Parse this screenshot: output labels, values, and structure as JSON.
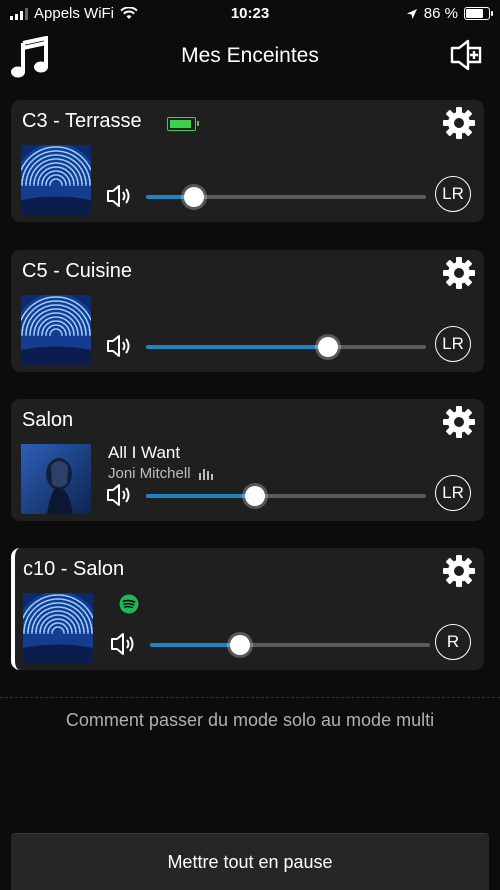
{
  "status": {
    "carrier": "Appels WiFi",
    "time": "10:23",
    "battery": "86 %"
  },
  "header": {
    "title": "Mes Enceintes"
  },
  "speakers": [
    {
      "name": "C3 - Terrasse",
      "volume": 0.17,
      "channel": "LR",
      "song": "",
      "artist": "",
      "battery_icon": "battery-full-green-icon"
    },
    {
      "name": "C5 - Cuisine",
      "volume": 0.65,
      "channel": "LR",
      "song": "",
      "artist": ""
    },
    {
      "name": "Salon",
      "volume": 0.39,
      "channel": "LR",
      "song": "All I Want",
      "artist": "Joni Mitchell"
    },
    {
      "name": "c10 - Salon",
      "volume": 0.32,
      "channel": "R",
      "song": "",
      "artist": "",
      "source_icon": "spotify-icon"
    }
  ],
  "help_text": "Comment passer du mode solo au mode multi",
  "pause_all_label": "Mettre tout en pause",
  "colors": {
    "accent": "#1c86c4",
    "card_bg": "#1f1f1f",
    "battery_green": "#3bd14a",
    "spotify": "#1db954"
  }
}
